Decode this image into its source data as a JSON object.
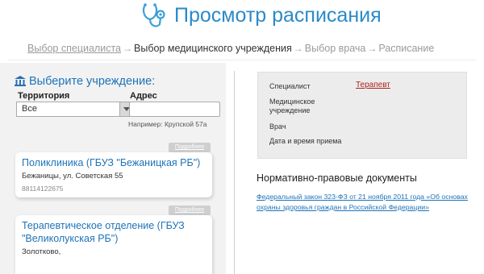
{
  "header": {
    "title": "Просмотр расписания",
    "logo_icon": "stethoscope-icon",
    "accent_color": "#2a8ac8"
  },
  "breadcrumb": {
    "steps": [
      "Выбор специалиста",
      "Выбор медицинского учреждения",
      "Выбор врача",
      "Расписание"
    ]
  },
  "institution": {
    "heading": "Выберите учреждение:",
    "icon": "building-icon",
    "territory_label": "Территория",
    "territory_value": "Все",
    "address_label": "Адрес",
    "address_value": "",
    "address_hint": "Например: Крупской 57а"
  },
  "cards": [
    {
      "more_label": "Подробнее",
      "title": "Поликлиника (ГБУЗ \"Бежаницкая РБ\")",
      "address": "Бежаницы, ул. Советская 55",
      "phone": "88114122675"
    },
    {
      "more_label": "Подробнее",
      "title": "Терапевтическое отделение (ГБУЗ \"Великолукская РБ\")",
      "address": "Золотково,",
      "phone": ""
    }
  ],
  "summary": {
    "specialist_label": "Специалист",
    "specialist_value": "Терапевт",
    "institution_label": "Медицинское учреждение",
    "doctor_label": "Врач",
    "datetime_label": "Дата и время приема"
  },
  "docs": {
    "title": "Нормативно-правовые документы",
    "link": "Федеральный закон 323-ФЗ от 21 ноября 2011 года «Об основах охраны здоровья граждан в Российской Федерации»"
  },
  "colors": {
    "link_blue": "#1e73b8",
    "specialist_red": "#b02020",
    "panel_gray": "#f2f2f2"
  }
}
